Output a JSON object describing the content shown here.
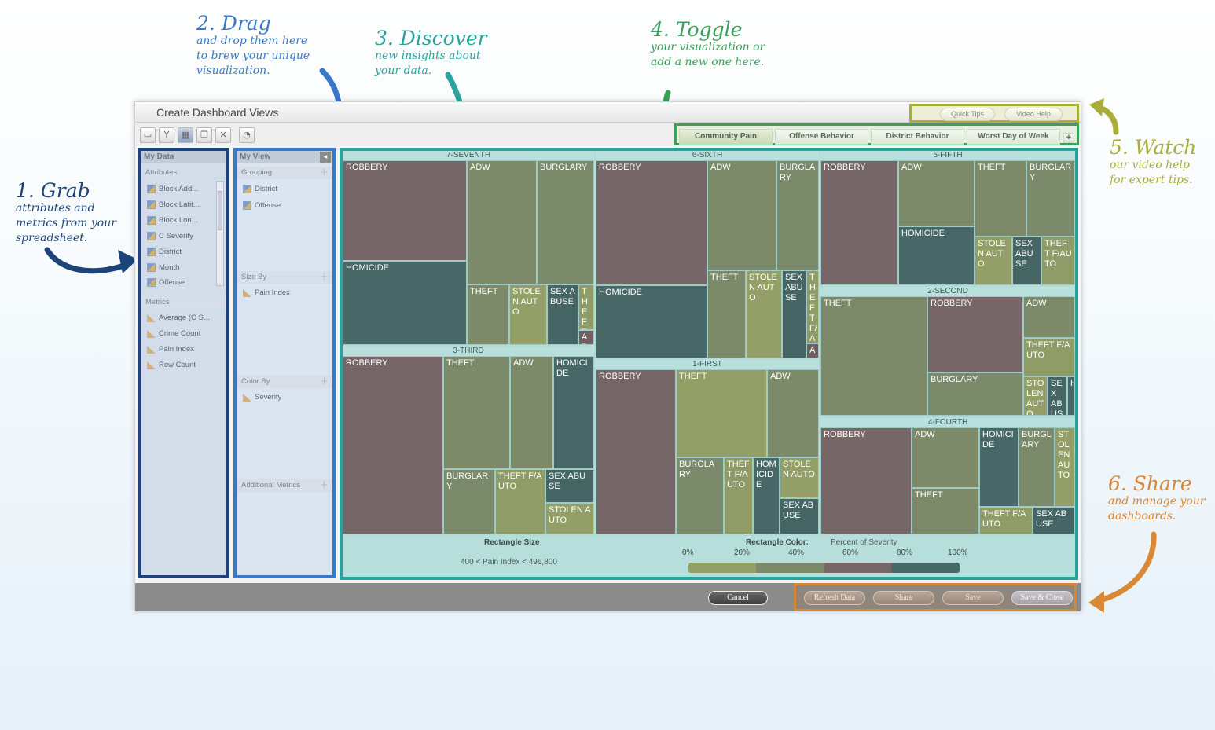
{
  "colors": {
    "step1": "#1d4478",
    "step2": "#3977c9",
    "step3": "#2aa39c",
    "step4": "#3aa05a",
    "step5": "#a9ad3a",
    "step6": "#d98836",
    "robbery": "#776667",
    "adw": "#7d8a6a",
    "burglary": "#7b8a6b",
    "homicide": "#476866",
    "stolen": "#949f68",
    "sexabuse": "#456665",
    "theft_fauto": "#8f9c67",
    "arson": "#6f5f63"
  },
  "annotations": {
    "step1": {
      "title": "1. Grab",
      "lines": [
        "attributes and",
        "metrics from your",
        "spreadsheet."
      ]
    },
    "step2": {
      "title": "2. Drag",
      "lines": [
        "and drop them here",
        "to brew your unique",
        "visualization."
      ]
    },
    "step3": {
      "title": "3. Discover",
      "lines": [
        "new insights about",
        "your data."
      ]
    },
    "step4": {
      "title": "4. Toggle",
      "lines": [
        "your visualization or",
        "add a new one here."
      ]
    },
    "step5": {
      "title": "5. Watch",
      "lines": [
        "our video help",
        "for expert tips."
      ]
    },
    "step6": {
      "title": "6. Share",
      "lines": [
        "and manage your",
        "dashboards."
      ]
    }
  },
  "window": {
    "title": "Create Dashboard Views",
    "quick_tips": "Quick Tips",
    "video_help": "Video Help"
  },
  "tabs": [
    "Community Pain",
    "Offense Behavior",
    "District Behavior",
    "Worst Day of Week"
  ],
  "my_data": {
    "header": "My Data",
    "attributes_label": "Attributes",
    "attributes": [
      "Block Add...",
      "Block Latit...",
      "Block Lon...",
      "C Severity",
      "District",
      "Month",
      "Offense"
    ],
    "metrics_label": "Metrics",
    "metrics": [
      "Average (C S...",
      "Crime Count",
      "Pain Index",
      "Row Count"
    ]
  },
  "my_view": {
    "header": "My View",
    "grouping_label": "Grouping",
    "grouping": [
      "District",
      "Offense"
    ],
    "size_label": "Size By",
    "size": [
      "Pain Index"
    ],
    "color_label": "Color By",
    "color": [
      "Severity"
    ],
    "additional_label": "Additional Metrics"
  },
  "treemap": {
    "districts": [
      "7-SEVENTH",
      "6-SIXTH",
      "5-FIFTH",
      "3-THIRD",
      "1-FIRST",
      "2-SECOND",
      "4-FOURTH"
    ],
    "cells": {
      "d7": [
        "ROBBERY",
        "ADW",
        "BURGLARY",
        "HOMICIDE",
        "THEFT",
        "STOLEN AUTO",
        "SEX ABUSE",
        "THEFT F/",
        "AR"
      ],
      "d6": [
        "ROBBERY",
        "ADW",
        "BURGLARY",
        "HOMICIDE",
        "THEFT",
        "STOLEN AUTO",
        "SEX ABUSE",
        "THEFT F/A",
        "A"
      ],
      "d5": [
        "ROBBERY",
        "ADW",
        "THEFT",
        "BURGLARY",
        "HOMICIDE",
        "STOLEN AUTO",
        "SEX ABUSE",
        "THEFT F/AUTO"
      ],
      "d3": [
        "ROBBERY",
        "THEFT",
        "ADW",
        "HOMICIDE",
        "BURGLARY",
        "THEFT F/AUTO",
        "SEX ABUSE",
        "STOLEN AUTO"
      ],
      "d1": [
        "ROBBERY",
        "THEFT",
        "ADW",
        "BURGLARY",
        "THEFT F/AUTO",
        "HOMICIDE",
        "STOLEN AUTO",
        "SEX ABUSE"
      ],
      "d2": [
        "THEFT",
        "ROBBERY",
        "ADW",
        "THEFT F/AUTO",
        "BURGLARY",
        "STOLEN AUTO",
        "SEX ABUSE",
        "H"
      ],
      "d4": [
        "ROBBERY",
        "ADW",
        "HOMICIDE",
        "BURGLARY",
        "STOLEN AUTO",
        "THEFT",
        "THEFT F/AUTO",
        "SEX ABUSE"
      ]
    }
  },
  "legend": {
    "size_title": "Rectangle Size",
    "size_range": "400 < Pain Index < 496,800",
    "color_title": "Rectangle Color:",
    "color_metric": "Percent of Severity",
    "ticks": [
      "0%",
      "20%",
      "40%",
      "60%",
      "80%",
      "100%"
    ]
  },
  "footer": {
    "cancel": "Cancel",
    "refresh": "Refresh Data",
    "share": "Share",
    "save": "Save",
    "save_close": "Save & Close"
  }
}
